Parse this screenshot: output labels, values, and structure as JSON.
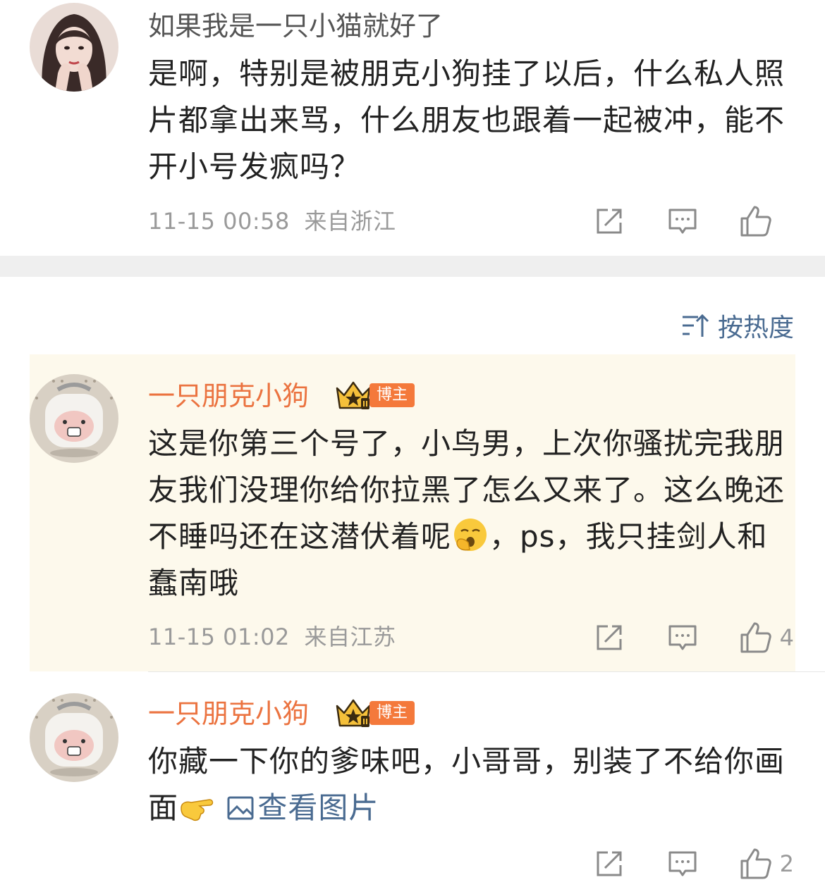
{
  "colors": {
    "username_orange": "#eb7340",
    "link_blue": "#4a6b91",
    "meta_gray": "#9a9a9a",
    "highlight_bg": "#fdf9ec",
    "badge_orange": "#f4793b"
  },
  "comments": [
    {
      "name": "如果我是一只小猫就好了",
      "text": "是啊，特别是被朋克小狗挂了以后，什么私人照片都拿出来骂，什么朋友也跟着一起被冲，能不开小号发疯吗？",
      "time": "11-15 00:58",
      "location": "来自浙江",
      "likes": "",
      "avatar_icon": "portrait-avatar-icon"
    },
    {
      "name": "一只朋克小狗",
      "badge": "博主",
      "text_before_emoji": "这是你第三个号了，小鸟男，上次你骚扰完我朋友我们没理你给你拉黑了怎么又来了。这么晚还不睡吗还在这潜伏着呢",
      "emoji_icon": "yawn-emoji-icon",
      "text_after_emoji": "，ps，我只挂剑人和蠢南哦",
      "time": "11-15 01:02",
      "location": "来自江苏",
      "likes": "4",
      "avatar_icon": "rice-cooker-avatar-icon"
    },
    {
      "name": "一只朋克小狗",
      "badge": "博主",
      "text": "你藏一下你的爹味吧，小哥哥，别装了不给你画面",
      "emoji_icon": "pointing-hand-emoji-icon",
      "view_image_label": "查看图片",
      "likes": "2",
      "avatar_icon": "rice-cooker-avatar-icon"
    }
  ],
  "sort": {
    "label": "按热度",
    "icon": "sort-icon"
  },
  "action_icons": [
    "share-icon",
    "comment-icon",
    "like-icon"
  ]
}
